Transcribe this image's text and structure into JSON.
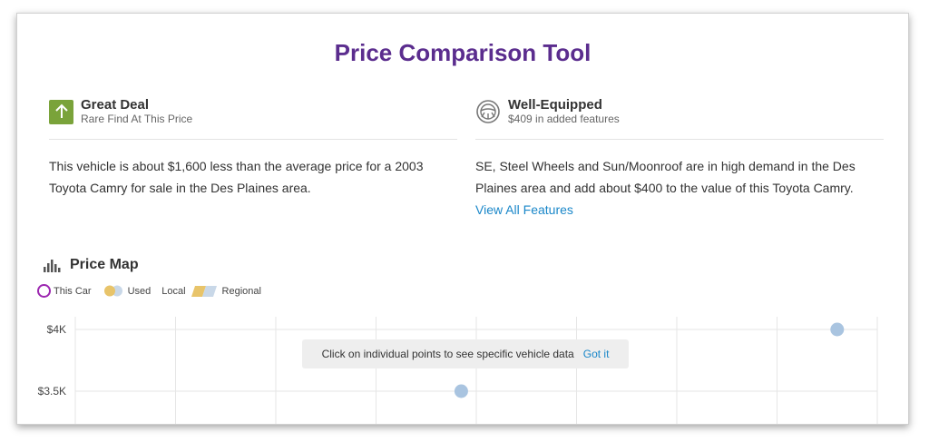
{
  "title": "Price Comparison Tool",
  "deal": {
    "title": "Great Deal",
    "subtitle": "Rare Find At This Price",
    "text": "This vehicle is about $1,600 less than the average price for a 2003 Toyota Camry for sale in the Des Plaines area."
  },
  "equipment": {
    "title": "Well-Equipped",
    "subtitle": "$409 in added features",
    "text": "SE, Steel Wheels and Sun/Moonroof are in high demand in the Des Plaines area and add about $400 to the value of this Toyota Camry.",
    "link": "View All Features"
  },
  "price_map": {
    "title": "Price Map",
    "legend": {
      "this_car": "This Car",
      "used": "Used",
      "local": "Local",
      "regional": "Regional"
    },
    "tooltip": {
      "text": "Click on individual points to see specific vehicle data",
      "action": "Got it"
    }
  },
  "colors": {
    "title": "#5b2d8e",
    "deal_green": "#7aa33a",
    "link": "#1a87c9",
    "point": "#a9c4e0"
  },
  "chart_data": {
    "type": "scatter",
    "ytick_labels": [
      "$4K",
      "$3.5K"
    ],
    "yticks": [
      4000,
      3500
    ],
    "ylim": [
      3450,
      4000
    ],
    "points": [
      {
        "x": 3.85,
        "y": 3500
      },
      {
        "x": 7.6,
        "y": 4000
      }
    ],
    "xlim": [
      0,
      8
    ],
    "grid": true
  }
}
